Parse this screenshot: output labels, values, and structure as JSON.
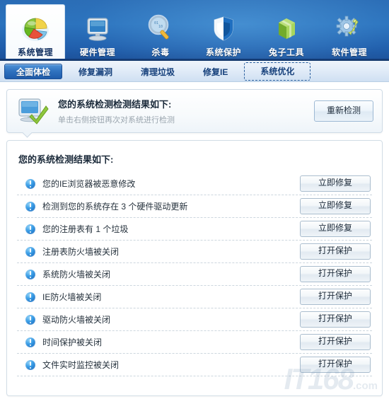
{
  "toolbar": {
    "items": [
      {
        "label": "系统管理",
        "icon": "pie-chart-icon",
        "active": true
      },
      {
        "label": "硬件管理",
        "icon": "monitor-icon",
        "active": false
      },
      {
        "label": "杀毒",
        "icon": "magnifier-icon",
        "active": false
      },
      {
        "label": "系统保护",
        "icon": "shield-icon",
        "active": false
      },
      {
        "label": "兔子工具",
        "icon": "green-box-icon",
        "active": false
      },
      {
        "label": "软件管理",
        "icon": "gear-wrench-icon",
        "active": false
      }
    ]
  },
  "tabs": [
    {
      "label": "全面体检",
      "active": true,
      "focused": false
    },
    {
      "label": "修复漏洞",
      "active": false,
      "focused": false
    },
    {
      "label": "清理垃圾",
      "active": false,
      "focused": false
    },
    {
      "label": "修复IE",
      "active": false,
      "focused": false
    },
    {
      "label": "系统优化",
      "active": false,
      "focused": true
    }
  ],
  "status_panel": {
    "icon": "monitor-check-icon",
    "title": "您的系统检测检测结果如下:",
    "subtitle": "单击右侧按钮再次对系统进行检测",
    "rescan_label": "重新检测"
  },
  "results": {
    "title": "您的系统检测结果如下:",
    "rows": [
      {
        "icon": "info-exclamation-icon",
        "text": "您的IE浏览器被恶意修改",
        "action": "立即修复"
      },
      {
        "icon": "info-exclamation-icon",
        "text": "检测到您的系统存在 3 个硬件驱动更新",
        "action": "立即修复"
      },
      {
        "icon": "info-exclamation-icon",
        "text": "您的注册表有 1 个垃圾",
        "action": "立即修复"
      },
      {
        "icon": "info-exclamation-icon",
        "text": "注册表防火墙被关闭",
        "action": "打开保护"
      },
      {
        "icon": "info-exclamation-icon",
        "text": "系统防火墙被关闭",
        "action": "打开保护"
      },
      {
        "icon": "info-exclamation-icon",
        "text": "IE防火墙被关闭",
        "action": "打开保护"
      },
      {
        "icon": "info-exclamation-icon",
        "text": "驱动防火墙被关闭",
        "action": "打开保护"
      },
      {
        "icon": "info-exclamation-icon",
        "text": "时间保护被关闭",
        "action": "打开保护"
      },
      {
        "icon": "info-exclamation-icon",
        "text": "文件实时监控被关闭",
        "action": "打开保护"
      }
    ]
  },
  "watermark": {
    "brand": "IT168",
    "suffix": ".com"
  },
  "colors": {
    "header_blue": "#2a6cb5",
    "header_blue_dark": "#1b4f97",
    "tab_active_blue": "#2f72bf",
    "icon_blue": "#1b74c8",
    "check_green": "#8fc73e",
    "panel_border": "#d2dde6"
  }
}
